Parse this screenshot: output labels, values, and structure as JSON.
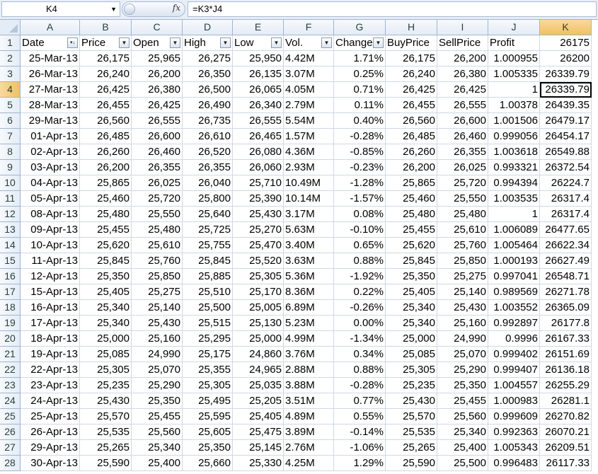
{
  "formula_bar": {
    "name_box": "K4",
    "fx_label": "fx",
    "formula": "=K3*J4"
  },
  "columns": [
    "A",
    "B",
    "C",
    "D",
    "E",
    "F",
    "G",
    "H",
    "I",
    "J",
    "K"
  ],
  "selected": {
    "col": "K",
    "row": "4"
  },
  "headers": [
    "Date",
    "Price",
    "Open",
    "High",
    "Low",
    "Vol.",
    "Change",
    "BuyPrice",
    "SellPrice",
    "Profit",
    "26175"
  ],
  "filter_icons": [
    "sort-desc",
    "down",
    "down",
    "down",
    "down",
    "down",
    "down",
    "none",
    "none",
    "none",
    "none"
  ],
  "rows": [
    [
      "2",
      "25-Mar-13",
      "26,175",
      "25,965",
      "26,275",
      "25,950",
      "4.42M",
      "1.71%",
      "26,175",
      "26,200",
      "1.000955",
      "26200"
    ],
    [
      "3",
      "26-Mar-13",
      "26,240",
      "26,200",
      "26,350",
      "26,135",
      "3.07M",
      "0.25%",
      "26,240",
      "26,380",
      "1.005335",
      "26339.79"
    ],
    [
      "4",
      "27-Mar-13",
      "26,425",
      "26,380",
      "26,500",
      "26,065",
      "4.05M",
      "0.71%",
      "26,425",
      "26,425",
      "1",
      "26339.79"
    ],
    [
      "5",
      "28-Mar-13",
      "26,455",
      "26,425",
      "26,490",
      "26,340",
      "2.79M",
      "0.11%",
      "26,455",
      "26,555",
      "1.00378",
      "26439.35"
    ],
    [
      "6",
      "29-Mar-13",
      "26,560",
      "26,555",
      "26,735",
      "26,555",
      "5.54M",
      "0.40%",
      "26,560",
      "26,600",
      "1.001506",
      "26479.17"
    ],
    [
      "7",
      "01-Apr-13",
      "26,485",
      "26,600",
      "26,610",
      "26,465",
      "1.57M",
      "-0.28%",
      "26,485",
      "26,460",
      "0.999056",
      "26454.17"
    ],
    [
      "8",
      "02-Apr-13",
      "26,260",
      "26,460",
      "26,520",
      "26,080",
      "4.36M",
      "-0.85%",
      "26,260",
      "26,355",
      "1.003618",
      "26549.88"
    ],
    [
      "9",
      "03-Apr-13",
      "26,200",
      "26,355",
      "26,355",
      "26,060",
      "2.93M",
      "-0.23%",
      "26,200",
      "26,025",
      "0.993321",
      "26372.54"
    ],
    [
      "10",
      "04-Apr-13",
      "25,865",
      "26,025",
      "26,040",
      "25,710",
      "10.49M",
      "-1.28%",
      "25,865",
      "25,720",
      "0.994394",
      "26224.7"
    ],
    [
      "11",
      "05-Apr-13",
      "25,460",
      "25,720",
      "25,800",
      "25,390",
      "10.14M",
      "-1.57%",
      "25,460",
      "25,550",
      "1.003535",
      "26317.4"
    ],
    [
      "12",
      "08-Apr-13",
      "25,480",
      "25,550",
      "25,640",
      "25,430",
      "3.17M",
      "0.08%",
      "25,480",
      "25,480",
      "1",
      "26317.4"
    ],
    [
      "13",
      "09-Apr-13",
      "25,455",
      "25,480",
      "25,725",
      "25,270",
      "5.63M",
      "-0.10%",
      "25,455",
      "25,610",
      "1.006089",
      "26477.65"
    ],
    [
      "14",
      "10-Apr-13",
      "25,620",
      "25,610",
      "25,755",
      "25,470",
      "3.40M",
      "0.65%",
      "25,620",
      "25,760",
      "1.005464",
      "26622.34"
    ],
    [
      "15",
      "11-Apr-13",
      "25,845",
      "25,760",
      "25,845",
      "25,520",
      "3.63M",
      "0.88%",
      "25,845",
      "25,850",
      "1.000193",
      "26627.49"
    ],
    [
      "16",
      "12-Apr-13",
      "25,350",
      "25,850",
      "25,885",
      "25,305",
      "5.36M",
      "-1.92%",
      "25,350",
      "25,275",
      "0.997041",
      "26548.71"
    ],
    [
      "17",
      "15-Apr-13",
      "25,405",
      "25,275",
      "25,510",
      "25,170",
      "8.36M",
      "0.22%",
      "25,405",
      "25,140",
      "0.989569",
      "26271.78"
    ],
    [
      "18",
      "16-Apr-13",
      "25,340",
      "25,140",
      "25,500",
      "25,005",
      "6.89M",
      "-0.26%",
      "25,340",
      "25,430",
      "1.003552",
      "26365.09"
    ],
    [
      "19",
      "17-Apr-13",
      "25,340",
      "25,430",
      "25,515",
      "25,130",
      "5.23M",
      "0.00%",
      "25,340",
      "25,160",
      "0.992897",
      "26177.8"
    ],
    [
      "20",
      "18-Apr-13",
      "25,000",
      "25,160",
      "25,295",
      "25,000",
      "4.99M",
      "-1.34%",
      "25,000",
      "24,990",
      "0.9996",
      "26167.33"
    ],
    [
      "21",
      "19-Apr-13",
      "25,085",
      "24,990",
      "25,175",
      "24,860",
      "3.76M",
      "0.34%",
      "25,085",
      "25,070",
      "0.999402",
      "26151.69"
    ],
    [
      "22",
      "22-Apr-13",
      "25,305",
      "25,070",
      "25,355",
      "24,965",
      "2.88M",
      "0.88%",
      "25,305",
      "25,290",
      "0.999407",
      "26136.18"
    ],
    [
      "23",
      "23-Apr-13",
      "25,235",
      "25,290",
      "25,305",
      "25,035",
      "3.88M",
      "-0.28%",
      "25,235",
      "25,350",
      "1.004557",
      "26255.29"
    ],
    [
      "24",
      "24-Apr-13",
      "25,430",
      "25,350",
      "25,495",
      "25,205",
      "3.51M",
      "0.77%",
      "25,430",
      "25,455",
      "1.000983",
      "26281.1"
    ],
    [
      "25",
      "25-Apr-13",
      "25,570",
      "25,455",
      "25,595",
      "25,405",
      "4.89M",
      "0.55%",
      "25,570",
      "25,560",
      "0.999609",
      "26270.82"
    ],
    [
      "26",
      "26-Apr-13",
      "25,535",
      "25,560",
      "25,605",
      "25,475",
      "3.89M",
      "-0.14%",
      "25,535",
      "25,340",
      "0.992363",
      "26070.21"
    ],
    [
      "27",
      "29-Apr-13",
      "25,265",
      "25,340",
      "25,350",
      "25,145",
      "2.76M",
      "-1.06%",
      "25,265",
      "25,400",
      "1.005343",
      "26209.51"
    ],
    [
      "28",
      "30-Apr-13",
      "25,590",
      "25,400",
      "25,660",
      "25,330",
      "4.25M",
      "1.29%",
      "25,590",
      "25,500",
      "0.996483",
      "26117.33"
    ]
  ]
}
